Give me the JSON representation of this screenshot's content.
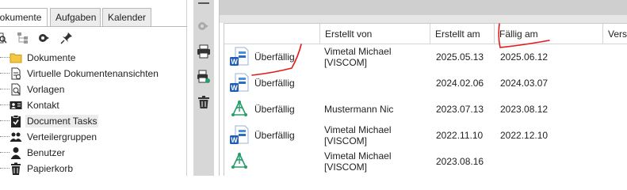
{
  "tabs": [
    {
      "label": "Dokumente",
      "active": true
    },
    {
      "label": "Aufgaben",
      "active": false
    },
    {
      "label": "Kalender",
      "active": false
    }
  ],
  "tree": [
    {
      "label": "Dokumente",
      "icon": "folder-icon"
    },
    {
      "label": "Virtuelle Dokumentenansichten",
      "icon": "document-view-icon"
    },
    {
      "label": "Vorlagen",
      "icon": "template-icon"
    },
    {
      "label": "Kontakt",
      "icon": "contact-card-icon"
    },
    {
      "label": "Document Tasks",
      "icon": "task-clipboard-icon",
      "selected": true
    },
    {
      "label": "Verteilergruppen",
      "icon": "group-icon"
    },
    {
      "label": "Benutzer",
      "icon": "user-icon"
    },
    {
      "label": "Papierkorb",
      "icon": "trash-icon"
    }
  ],
  "grid": {
    "columns": [
      "",
      "Erstellt von",
      "Erstellt am",
      "Fällig am",
      "Vers"
    ],
    "rows": [
      {
        "icon": "word-document-icon",
        "status": "Überfällig",
        "author_line1": "Vimetal Michael",
        "author_line2": "[VISCOM]",
        "created": "2025.05.13",
        "due": "2025.06.12"
      },
      {
        "icon": "word-document-icon",
        "status": "Überfällig",
        "author_line1": "",
        "author_line2": "",
        "created": "2024.02.06",
        "due": "2024.03.07"
      },
      {
        "icon": "workflow-leaf-icon",
        "status": "Überfällig",
        "author_line1": "Mustermann Nic",
        "author_line2": "",
        "created": "2023.07.13",
        "due": "2023.08.12"
      },
      {
        "icon": "word-document-icon",
        "status": "Überfällig",
        "author_line1": "Vimetal Michael",
        "author_line2": "[VISCOM]",
        "created": "2022.11.10",
        "due": "2022.12.10"
      },
      {
        "icon": "workflow-leaf-icon",
        "status": "",
        "author_line1": "Vimetal Michael",
        "author_line2": "[VISCOM]",
        "created": "2023.08.16",
        "due": ""
      }
    ]
  },
  "colors": {
    "annotation_red": "#e31b1b",
    "word_blue": "#1f5bb8",
    "leaf_green": "#2a9d6c"
  }
}
